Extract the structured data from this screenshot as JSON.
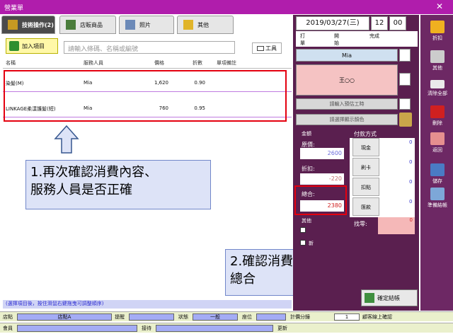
{
  "window": {
    "title": "營業單",
    "close": "✕"
  },
  "tabs": [
    {
      "label": "技術操作(2)",
      "active": true
    },
    {
      "label": "店販商品"
    },
    {
      "label": "照片"
    },
    {
      "label": "其他"
    }
  ],
  "toolbar": {
    "add_item": "加入項目",
    "search_placeholder": "請輸入條碼、名稱或編號",
    "tool_button": "工具"
  },
  "table": {
    "headers": [
      "名稱",
      "服務人員",
      "價格",
      "折數",
      "單項備註"
    ],
    "rows": [
      {
        "name": "染髮(M)",
        "staff": "Mia",
        "price": "1,620",
        "discount": "0.90",
        "note": ""
      },
      {
        "name": "LINKAGE柔漾護髮(短)",
        "staff": "Mia",
        "price": "760",
        "discount": "0.95",
        "note": ""
      }
    ]
  },
  "grid_note": "(選擇項目後，按住滑鼠右鍵拖曳可調整順序)",
  "callouts": {
    "left": [
      "1.再次確認消費內容、",
      "服務人員是否正確"
    ],
    "right": [
      "2.確認消費金額",
      "總合"
    ]
  },
  "right_panel": {
    "date": "2019/03/27(三)",
    "hour": "12",
    "minute": "00",
    "time_labels": [
      "打單",
      "開始",
      "完成"
    ],
    "stylist": "Mia",
    "customer": "王○○",
    "time_btn": "請輸入預估工時",
    "color_btn": "請選擇顯示顏色",
    "amount_group": "金額",
    "original_price_label": "原價:",
    "original_price": "2600",
    "discount_label": "折扣:",
    "discount": "-220",
    "total_label": "總合:",
    "total": "2380",
    "payment_group": "付款方式",
    "payments": [
      {
        "label": "現金",
        "value": "0"
      },
      {
        "label": "刷卡",
        "value": "0"
      },
      {
        "label": "扣點",
        "value": "0"
      },
      {
        "label": "匯款",
        "value": "0"
      }
    ],
    "change_label": "找零:",
    "change": "0",
    "other_group": "其他",
    "checkbox_labels": [
      "新"
    ],
    "confirm": "確定結帳"
  },
  "sidebar": [
    {
      "label": "折扣"
    },
    {
      "label": "其他"
    },
    {
      "label": "清除全部"
    },
    {
      "label": "刪除"
    },
    {
      "label": "返回"
    },
    {
      "label": "儲存"
    },
    {
      "label": "準備結帳"
    }
  ],
  "status_bar": {
    "row1": [
      {
        "label": "店點",
        "value": "店點A"
      },
      {
        "label": "提醒",
        "value": ""
      },
      {
        "label": "狀態",
        "value": "一般"
      },
      {
        "label": "座位",
        "value": ""
      },
      {
        "label": "計價分鐘",
        "value": "1"
      },
      {
        "label": "顧客線上確認",
        "value": ""
      }
    ],
    "row2": [
      {
        "label": "會員",
        "value": ""
      },
      {
        "label": "接待",
        "value": ""
      },
      {
        "label": "更新",
        "value": ""
      }
    ]
  },
  "colors": {
    "titlebar": "#b01dac",
    "panel": "#5a1f4f",
    "accent_red": "#e4000f",
    "callout_bg": "#dde3f7"
  }
}
